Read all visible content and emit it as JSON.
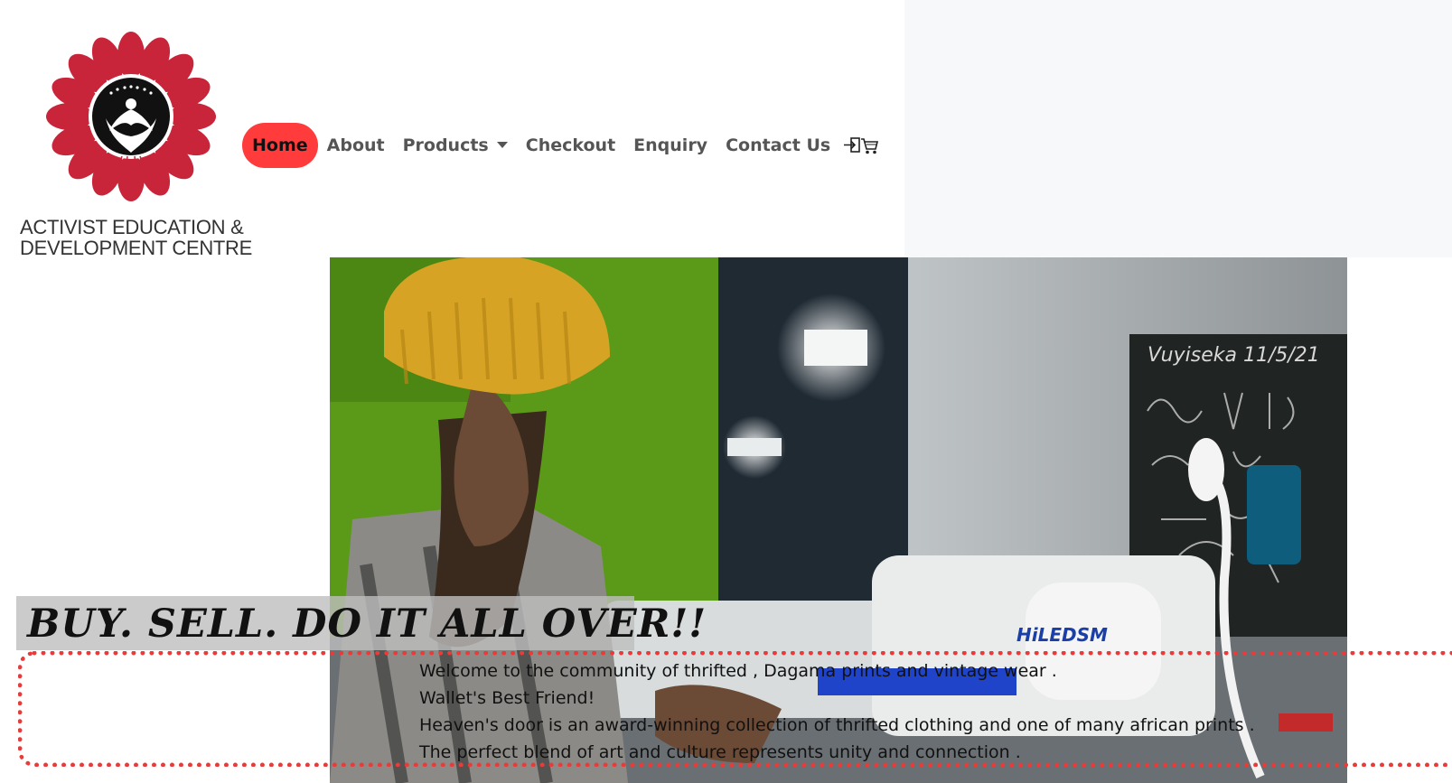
{
  "brand": {
    "line1": "ACTIVIST EDUCATION &",
    "line2": "DEVELOPMENT CENTRE",
    "colors": {
      "petal": "#c8253a",
      "emblem": "#111111"
    }
  },
  "nav": {
    "items": [
      {
        "label": "Home",
        "active": true
      },
      {
        "label": "About"
      },
      {
        "label": "Products",
        "dropdown": true
      },
      {
        "label": "Checkout"
      },
      {
        "label": "Enquiry"
      },
      {
        "label": "Contact Us"
      }
    ],
    "cart_icon": "login-cart-icon",
    "accent_color": "#ff3b3b"
  },
  "hero": {
    "image_icon": "hero-photo",
    "chalkboard_text": "Vuyiseka  11/5/21"
  },
  "headline": "BUY. SELL. DO IT ALL OVER!!",
  "welcome": {
    "lines": [
      "Welcome to the community of thrifted , Dagama prints and vintage wear .",
      "Wallet's Best Friend!",
      "Heaven's door is an award-winning collection of thrifted clothing and one of many african prints .",
      "The perfect blend of art and culture represents unity and connection ."
    ]
  }
}
